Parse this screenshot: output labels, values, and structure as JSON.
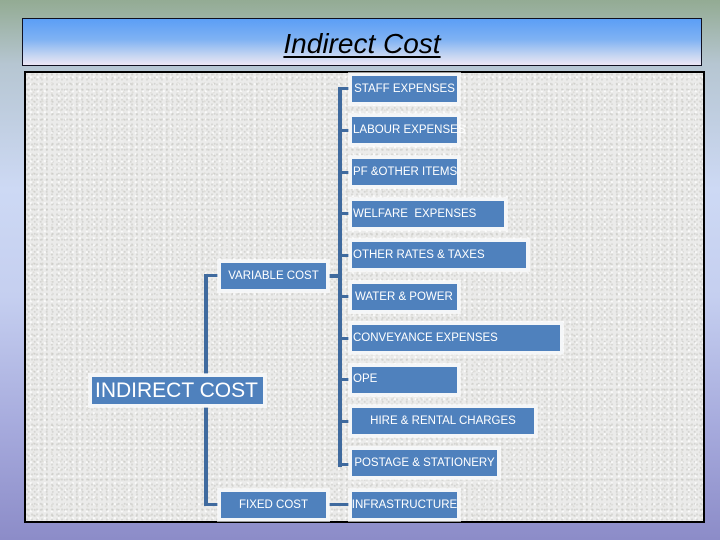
{
  "slide": {
    "title": "Indirect Cost"
  },
  "diagram": {
    "root": {
      "label": "INDIRECT COST"
    },
    "branches": [
      {
        "label": "VARIABLE COST",
        "children": [
          "STAFF EXPENSES",
          "LABOUR EXPENSES",
          "PF &OTHER ITEMS",
          "WELFARE  EXPENSES",
          "OTHER RATES & TAXES",
          "WATER & POWER",
          "CONVEYANCE EXPENSES",
          "OPE",
          "HIRE & RENTAL CHARGES",
          "POSTAGE & STATIONERY"
        ]
      },
      {
        "label": "FIXED COST",
        "children": [
          "INFRASTRUCTURE"
        ]
      }
    ]
  },
  "colors": {
    "node_fill": "#4f81bd",
    "node_border": "#ffffff",
    "connector": "#3f6a9e",
    "title_gradient_top": "#5b9ef6",
    "title_gradient_bottom": "#ece6f4"
  }
}
